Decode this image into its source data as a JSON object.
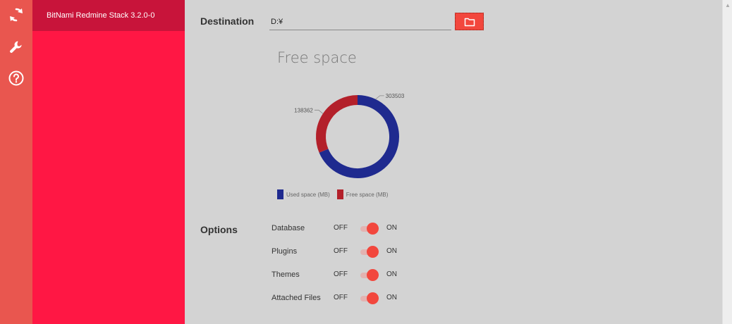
{
  "rail": {
    "items": [
      {
        "icon": "refresh-icon"
      },
      {
        "icon": "wrench-icon"
      },
      {
        "icon": "help-icon"
      }
    ]
  },
  "sidebar": {
    "items": [
      {
        "label": "BitNami Redmine Stack 3.2.0-0",
        "selected": true
      }
    ]
  },
  "destination": {
    "label": "Destination",
    "value": "D:¥",
    "browse_icon": "folder-icon"
  },
  "chart_data": {
    "type": "pie",
    "title": "Free space",
    "series": [
      {
        "name": "Used space (MB)",
        "value": 303503,
        "label": "303503",
        "color": "#1f2a8f"
      },
      {
        "name": "Free space (MB)",
        "value": 138362,
        "label": "138362",
        "color": "#b3202a"
      }
    ],
    "legend_placement": "bottom-left"
  },
  "options": {
    "label": "Options",
    "off_label": "OFF",
    "on_label": "ON",
    "items": [
      {
        "label": "Database",
        "state": "on"
      },
      {
        "label": "Plugins",
        "state": "on"
      },
      {
        "label": "Themes",
        "state": "on"
      },
      {
        "label": "Attached Files",
        "state": "on"
      }
    ]
  },
  "colors": {
    "accent": "#f2473d",
    "sidebar": "#ff1744",
    "sidebar_selected": "#c8143a",
    "rail": "#e9564f"
  }
}
